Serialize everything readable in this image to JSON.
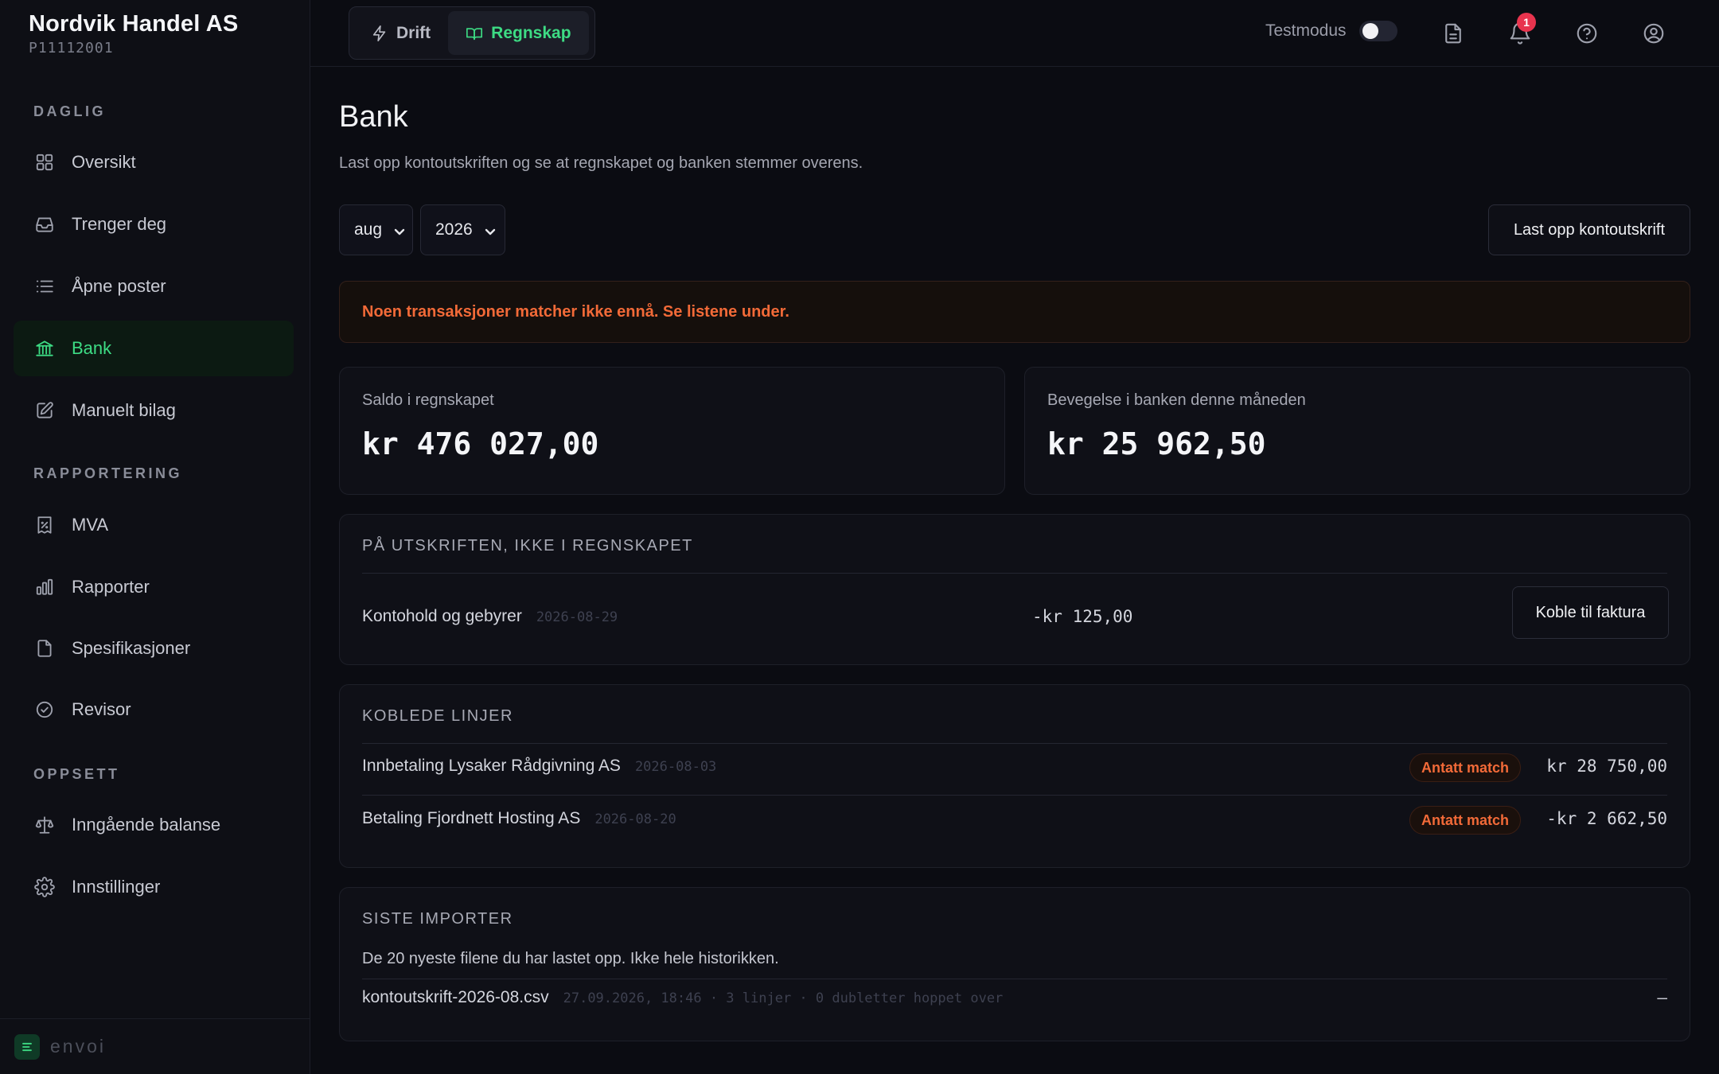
{
  "company": {
    "name": "Nordvik Handel AS",
    "id": "P11112001"
  },
  "sidebar": {
    "sections": [
      {
        "label": "DAGLIG"
      },
      {
        "label": "RAPPORTERING"
      },
      {
        "label": "OPPSETT"
      }
    ],
    "items": [
      {
        "label": "Oversikt",
        "icon": "grid-icon"
      },
      {
        "label": "Trenger deg",
        "icon": "inbox-icon"
      },
      {
        "label": "Åpne poster",
        "icon": "list-icon"
      },
      {
        "label": "Bank",
        "icon": "bank-icon",
        "active": true
      },
      {
        "label": "Manuelt bilag",
        "icon": "edit-icon"
      },
      {
        "label": "MVA",
        "icon": "receipt-percent-icon"
      },
      {
        "label": "Rapporter",
        "icon": "bar-chart-icon"
      },
      {
        "label": "Spesifikasjoner",
        "icon": "file-icon"
      },
      {
        "label": "Revisor",
        "icon": "check-circle-icon"
      },
      {
        "label": "Inngående balanse",
        "icon": "scale-icon"
      },
      {
        "label": "Innstillinger",
        "icon": "gear-icon"
      }
    ],
    "brand": "envoi"
  },
  "topbar": {
    "tabs": [
      {
        "label": "Drift",
        "icon": "bolt-icon"
      },
      {
        "label": "Regnskap",
        "icon": "book-icon",
        "active": true
      }
    ],
    "testmode_label": "Testmodus",
    "notifications_count": "1"
  },
  "page": {
    "title": "Bank",
    "subtitle": "Last opp kontoutskriften og se at regnskapet og banken stemmer overens.",
    "month": "aug",
    "year": "2026",
    "upload_button": "Last opp kontoutskrift",
    "alert": "Noen transaksjoner matcher ikke ennå. Se listene under."
  },
  "stats": {
    "ledger_label": "Saldo i regnskapet",
    "ledger_value": "kr 476 027,00",
    "bank_label": "Bevegelse i banken denne måneden",
    "bank_value": "kr 25 962,50"
  },
  "unmatched": {
    "heading": "PÅ UTSKRIFTEN, IKKE I REGNSKAPET",
    "rows": [
      {
        "title": "Kontohold og gebyrer",
        "date": "2026-08-29",
        "amount": "-kr 125,00",
        "action": "Koble til faktura"
      }
    ]
  },
  "linked": {
    "heading": "KOBLEDE LINJER",
    "rows": [
      {
        "title": "Innbetaling Lysaker Rådgivning AS",
        "date": "2026-08-03",
        "status": "Antatt match",
        "amount": "kr 28 750,00"
      },
      {
        "title": "Betaling Fjordnett Hosting AS",
        "date": "2026-08-20",
        "status": "Antatt match",
        "amount": "-kr 2 662,50"
      }
    ]
  },
  "imports": {
    "heading": "SISTE IMPORTER",
    "note": "De 20 nyeste filene du har lastet opp. Ikke hele historikken.",
    "rows": [
      {
        "file": "kontoutskrift-2026-08.csv",
        "meta": "27.09.2026, 18:46 · 3 linjer · 0 dubletter hoppet over",
        "action": "–"
      }
    ]
  },
  "colors": {
    "accent": "#3ddc84",
    "warning": "#f26a38",
    "badge": "#e8344e",
    "background": "#0b0c12"
  }
}
